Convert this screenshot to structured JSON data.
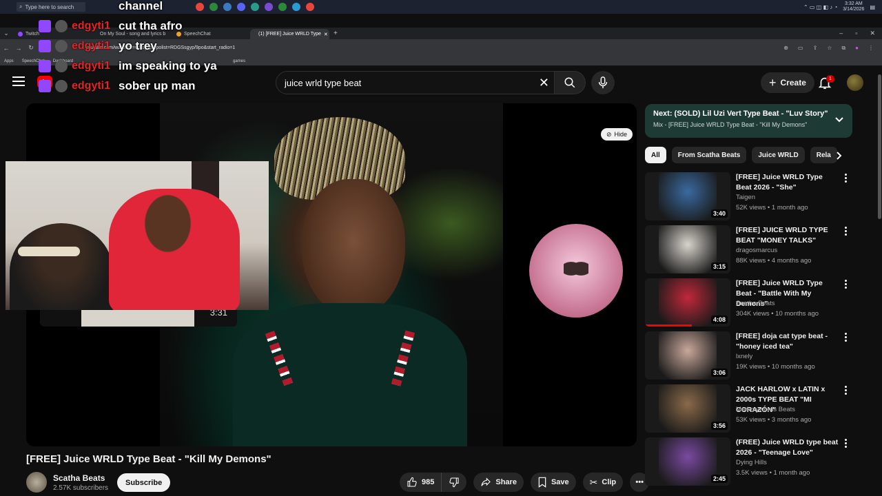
{
  "taskbar": {
    "search_placeholder": "Type here to search",
    "time": "3:32 AM",
    "date": "3/14/2026"
  },
  "browser": {
    "tabs": [
      {
        "label": "Twitch",
        "color": "#9147ff",
        "active": false
      },
      {
        "label": "On My Soul - song and lyrics b",
        "color": "#1db954",
        "active": false
      },
      {
        "label": "SpeechChat",
        "color": "#f0a030",
        "active": false
      },
      {
        "label": "(1) [FREE] Juice WRLD Type",
        "color": "#ff0000",
        "active": true
      }
    ],
    "url": "youtube.com/watch?v=GSsgyp/9polist=RDGSsgyp/9po&start_radio=1",
    "bookmarks": [
      "Apps",
      "SpeechChat",
      "Dashboard",
      "games"
    ]
  },
  "chat": [
    {
      "user": "channel",
      "message": ""
    },
    {
      "user": "edgyti1",
      "message": "cut tha afro"
    },
    {
      "user": "edgyti1",
      "message": "yo trey"
    },
    {
      "user": "edgyti1",
      "message": "im speaking to ya"
    },
    {
      "user": "edgyti1",
      "message": "sober up man"
    }
  ],
  "header": {
    "search_query": "juice wrld type beat",
    "create_label": "Create",
    "notification_count": "1"
  },
  "player": {
    "hide_label": "Hide",
    "preview_time": "3:31"
  },
  "video": {
    "title": "[FREE] Juice WRLD Type Beat - \"Kill My Demons\"",
    "channel": "Scatha Beats",
    "subscribers": "2.57K subscribers",
    "subscribe_label": "Subscribe",
    "likes": "985",
    "share_label": "Share",
    "save_label": "Save",
    "clip_label": "Clip"
  },
  "up_next": {
    "title": "Next: (SOLD) Lil Uzi Vert Type Beat - \"Luv Story\"",
    "subtitle": "Mix - [FREE] Juice WRLD Type Beat - \"Kill My Demons\""
  },
  "chips": [
    "All",
    "From Scatha Beats",
    "Juice WRLD",
    "Rela"
  ],
  "recommendations": [
    {
      "title": "[FREE] Juice WRLD Type Beat 2026 - \"She\"",
      "channel": "Taigen",
      "meta": "52K views • 1 month ago",
      "duration": "3:40",
      "color": "#3a6aa0"
    },
    {
      "title": "[FREE] JUICE WRLD TYPE BEAT \"MONEY TALKS\"",
      "channel": "dragosmarcus",
      "meta": "88K views • 4 months ago",
      "duration": "3:15",
      "color": "#d8d4cc"
    },
    {
      "title": "[FREE] Juice WRLD Type Beat - \"Battle With My Demons\"",
      "channel": "Scatha Beats",
      "meta": "304K views • 10 months ago",
      "duration": "4:08",
      "color": "#c0283a"
    },
    {
      "title": "[FREE] doja cat type beat - \"honey iced tea\"",
      "channel": "lxnely",
      "meta": "19K views • 10 months ago",
      "duration": "3:06",
      "color": "#c9a89a"
    },
    {
      "title": "JACK HARLOW x LATIN x 2000s TYPE BEAT \"MI CORAZÓN\"",
      "channel": "Markmywords Beats",
      "meta": "53K views • 3 months ago",
      "duration": "3:56",
      "color": "#8a6a4a"
    },
    {
      "title": "(FREE) Juice WRLD type beat 2026 - \"Teenage Love\"",
      "channel": "Dying Hills",
      "meta": "3.5K views • 1 month ago",
      "duration": "2:45",
      "color": "#7a4aa0"
    }
  ]
}
